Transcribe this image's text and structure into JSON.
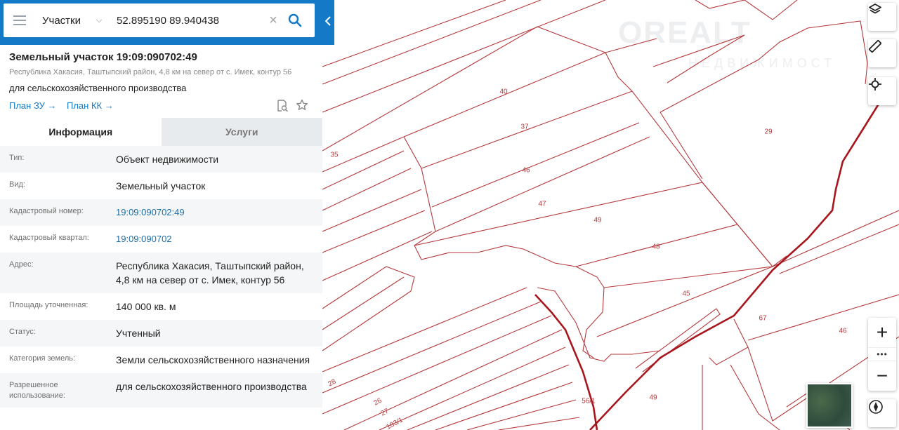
{
  "search": {
    "layer_label": "Участки",
    "query": "52.895190 89.940438"
  },
  "panel": {
    "title": "Земельный участок 19:09:090702:49",
    "address": "Республика Хакасия, Таштыпский район, 4,8 км на север от с. Имек, контур 56",
    "use": "для сельскохозяйственного производства",
    "plan_zu": "План ЗУ →",
    "plan_kk": "План КК →",
    "tabs": [
      {
        "label": "Информация",
        "active": true
      },
      {
        "label": "Услуги",
        "active": false
      }
    ],
    "rows": [
      {
        "label": "Тип:",
        "value": "Объект недвижимости"
      },
      {
        "label": "Вид:",
        "value": "Земельный участок"
      },
      {
        "label": "Кадастровый номер:",
        "value": "19:09:090702:49"
      },
      {
        "label": "Кадастровый квартал:",
        "value": "19:09:090702"
      },
      {
        "label": "Адрес:",
        "value": "Республика Хакасия, Таштыпский район, 4,8 км на север от с. Имек, контур 56"
      },
      {
        "label": "Площадь уточненная:",
        "value": "140 000 кв. м"
      },
      {
        "label": "Статус:",
        "value": "Учтенный"
      },
      {
        "label": "Категория земель:",
        "value": "Земли сельскохозяйственного назначения"
      },
      {
        "label": "Разрешенное использование:",
        "value": "для сельскохозяйственного производства"
      }
    ]
  },
  "map": {
    "watermark": "OREALT",
    "watermark_sub": "НЕДВИЖИМОСТ",
    "parcel_labels": [
      "40",
      "37",
      "46",
      "47",
      "49",
      "48",
      "45",
      "29",
      "35",
      "67",
      "46",
      "28",
      "26",
      "27",
      "183/1",
      "56/1",
      "49"
    ],
    "zoom_in": "+",
    "zoom_more": "•••",
    "zoom_out": "−"
  },
  "colors": {
    "brand": "#1479c7",
    "parcel_line": "#b5393c",
    "road": "#a8161d"
  }
}
